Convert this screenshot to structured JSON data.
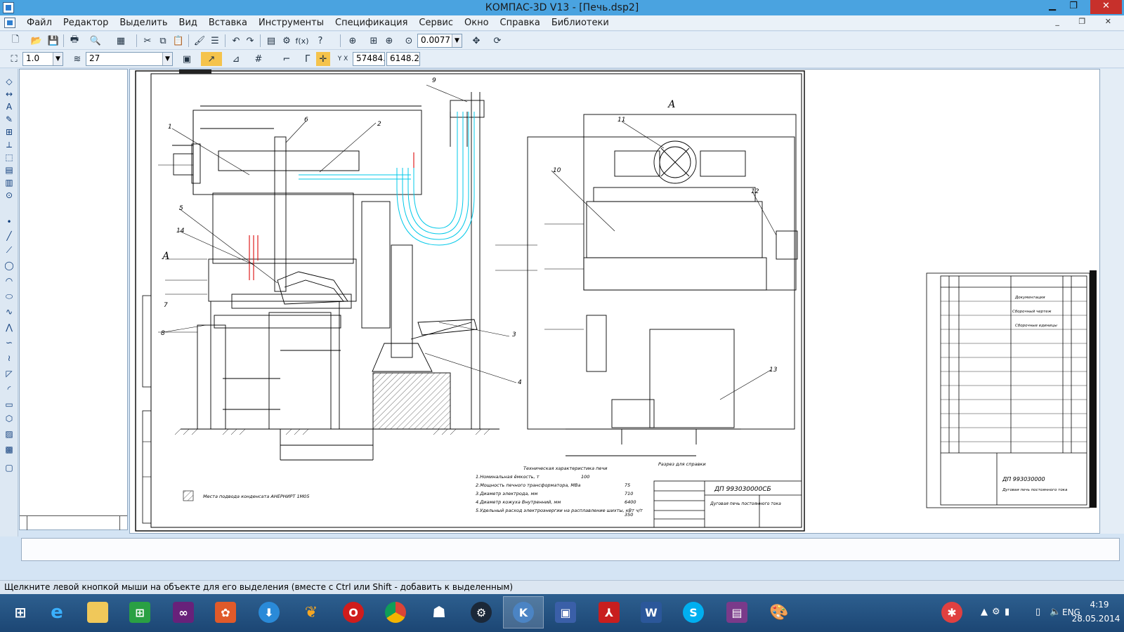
{
  "window": {
    "title": "КОМПАС-3D V13 - [Печь.dsp2]",
    "minimize": "▁",
    "maximize": "❐",
    "close": "✕"
  },
  "menu": {
    "items": [
      "Файл",
      "Редактор",
      "Выделить",
      "Вид",
      "Вставка",
      "Инструменты",
      "Спецификация",
      "Сервис",
      "Окно",
      "Справка",
      "Библиотеки"
    ],
    "mdi_controls": "_ ❐ ✕"
  },
  "toolbar1": {
    "zoom_value": "0.0077",
    "fx_label": "f(x)"
  },
  "toolbar2": {
    "scale_value": "1.0",
    "layer_value": "27",
    "coord_x": "57484.7",
    "coord_y": "6148.2"
  },
  "drawing": {
    "section_label_left": "А",
    "section_label_right": "А",
    "callouts": [
      "1",
      "2",
      "3",
      "4",
      "5",
      "6",
      "7",
      "8",
      "9",
      "10",
      "11",
      "12",
      "13",
      "14"
    ],
    "tech_title": "Техническая характеристика печи",
    "tech_rows": [
      {
        "label": "1.Номинальная ёмкость, т",
        "value": "100"
      },
      {
        "label": "2.Мощность печного трансформатора, МВа",
        "value": "75"
      },
      {
        "label": "3.Диаметр электрода, мм",
        "value": "710"
      },
      {
        "label": "4.Диаметр кожуха  Внутренний, мм",
        "value": "6400"
      },
      {
        "label": "5.Удельный расход электроэнергии на расплавление шихты, кВт ч/т",
        "value": "350"
      }
    ],
    "legend_text": "Места подвода конденсата АНЕРНИРТ 1М05",
    "stamp_code": "ДП 993030000СБ",
    "stamp_name": "Дуговая печь постоянного тока",
    "right_caption": "Разрез для справки",
    "spec_code": "ДП 993030000",
    "spec_name": "Дуговая печь постоянного тока",
    "spec_section1": "Документация",
    "spec_row1": "Сборочный чертеж",
    "spec_section2": "Сборочные единицы"
  },
  "status": {
    "text": "Щелкните левой кнопкой мыши на объекте для его выделения (вместе с Ctrl или Shift - добавить к выделенным)"
  },
  "taskbar": {
    "apps": [
      "start",
      "internet-explorer",
      "file-explorer",
      "store",
      "visual-studio",
      "paint-app",
      "download-app",
      "butterfly-app",
      "opera",
      "chrome",
      "alien-app",
      "steam",
      "kompas",
      "floppy-app",
      "acrobat",
      "word",
      "skype",
      "winrar",
      "paint-palette"
    ],
    "language": "ENG",
    "time": "4:19",
    "date": "28.05.2014"
  },
  "colors": {
    "titlebar": "#4aa3e0",
    "taskbar": "#1f4f80",
    "accent_cyan": "#00c8e8",
    "accent_red": "#e02020"
  }
}
